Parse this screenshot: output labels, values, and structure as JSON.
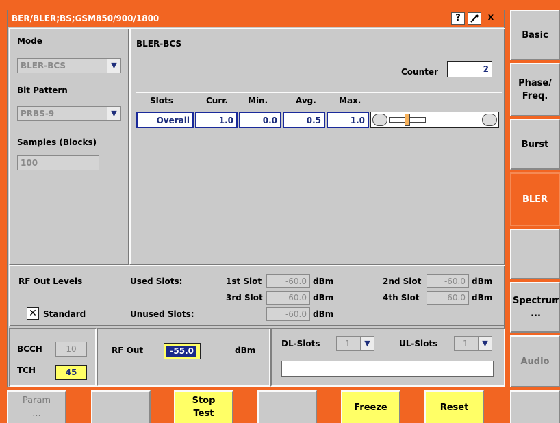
{
  "window": {
    "title": "BER/BLER;BS;GSM850/900/1800",
    "help_label": "?",
    "close_label": "x"
  },
  "left": {
    "mode_label": "Mode",
    "mode_value": "BLER-BCS",
    "bit_pattern_label": "Bit Pattern",
    "bit_pattern_value": "PRBS-9",
    "samples_label": "Samples (Blocks)",
    "samples_value": "100"
  },
  "results": {
    "title": "BLER-BCS",
    "counter_label": "Counter",
    "counter_value": "2",
    "columns": [
      "Slots",
      "Curr.",
      "Min.",
      "Avg.",
      "Max."
    ],
    "row": {
      "slot": "Overall",
      "curr": "1.0",
      "min": "0.0",
      "avg": "0.5",
      "max": "1.0"
    },
    "slider_position": 0.5
  },
  "rf_out_levels": {
    "label": "RF Out Levels",
    "used_slots_label": "Used Slots:",
    "unused_slots_label": "Unused Slots:",
    "standard_label": "Standard",
    "standard_checked": true,
    "slot1_label": "1st Slot",
    "slot1_value": "-60.0",
    "slot2_label": "2nd Slot",
    "slot2_value": "-60.0",
    "slot3_label": "3rd Slot",
    "slot3_value": "-60.0",
    "slot4_label": "4th Slot",
    "slot4_value": "-60.0",
    "unused_value": "-60.0",
    "unit": "dBm"
  },
  "bottom": {
    "bcch_label": "BCCH",
    "bcch_value": "10",
    "tch_label": "TCH",
    "tch_value": "45",
    "rf_out_label": "RF Out",
    "rf_out_value": "-55.0",
    "rf_out_unit": "dBm",
    "dl_slots_label": "DL-Slots",
    "dl_slots_value": "1",
    "ul_slots_label": "UL-Slots",
    "ul_slots_value": "1",
    "message": ""
  },
  "nav": {
    "basic": "Basic",
    "phase_line1": "Phase/",
    "phase_line2": "Freq.",
    "burst": "Burst",
    "bler": "BLER",
    "spectrum_line1": "Spectrum",
    "spectrum_line2": "...",
    "audio": "Audio"
  },
  "softkeys": {
    "param_line1": "Param",
    "param_line2": "...",
    "stop_line1": "Stop",
    "stop_line2": "Test",
    "freeze": "Freeze",
    "reset": "Reset"
  },
  "colors": {
    "accent": "#f26522",
    "highlight": "#ffff66",
    "value_blue": "#1a2a7a"
  }
}
